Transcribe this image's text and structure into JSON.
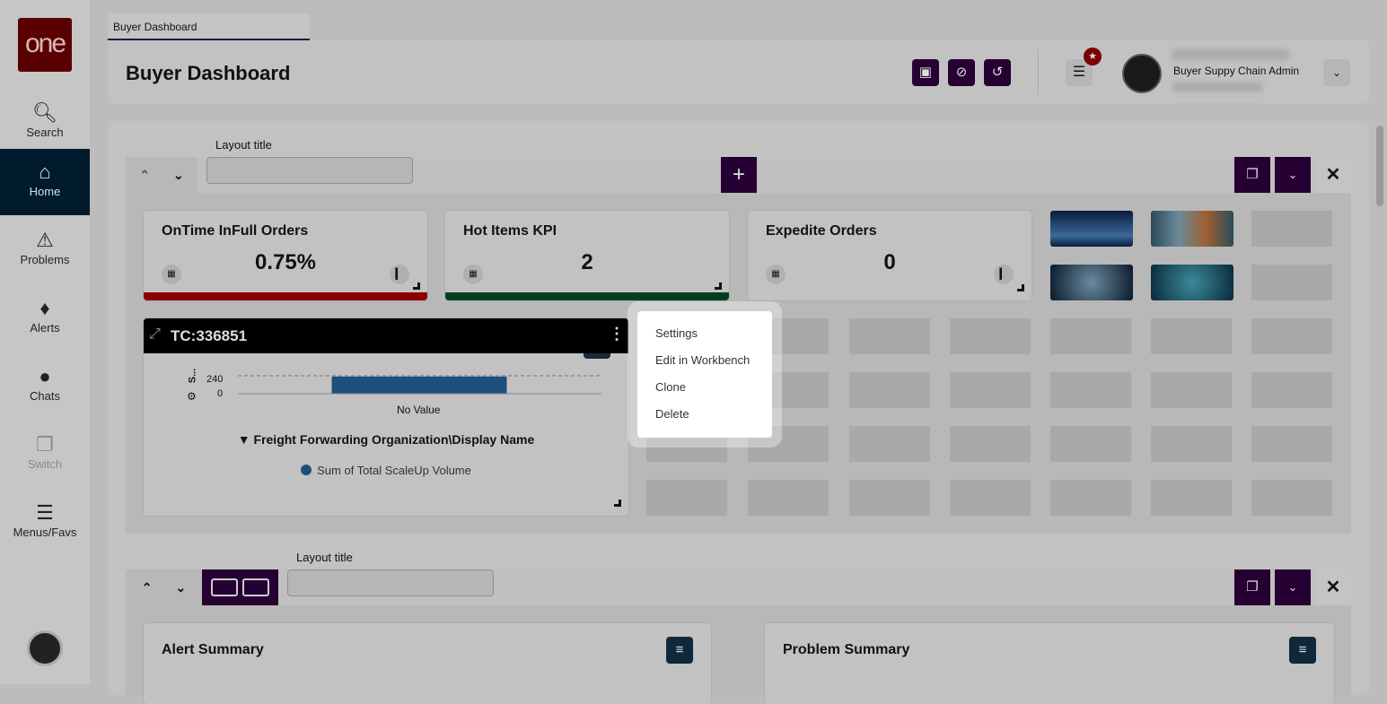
{
  "sidebar": {
    "logo": "one",
    "items": [
      {
        "label": "Search",
        "icon": "search-icon"
      },
      {
        "label": "Home",
        "icon": "home-icon",
        "active": true
      },
      {
        "label": "Problems",
        "icon": "warning-icon"
      },
      {
        "label": "Alerts",
        "icon": "bell-icon"
      },
      {
        "label": "Chats",
        "icon": "chat-icon"
      },
      {
        "label": "Switch",
        "icon": "switch-icon",
        "disabled": true
      },
      {
        "label": "Menus/Favs",
        "icon": "menu-icon"
      }
    ]
  },
  "tab": {
    "label": "Buyer Dashboard"
  },
  "header": {
    "title": "Buyer Dashboard",
    "user_role": "Buyer Suppy Chain Admin"
  },
  "layout1": {
    "title_label": "Layout title",
    "title_value": "",
    "kpis": [
      {
        "title": "OnTime InFull Orders",
        "value": "0.75%",
        "bar_color": "#8b0000"
      },
      {
        "title": "Hot Items KPI",
        "value": "2",
        "bar_color": "#004020"
      },
      {
        "title": "Expedite Orders",
        "value": "0",
        "bar_color": ""
      }
    ]
  },
  "widget": {
    "title": "TC:336851",
    "y_axis_label": "S...",
    "chart_data": {
      "type": "bar",
      "categories": [
        "No Value"
      ],
      "values": [
        230
      ],
      "ylim": [
        0,
        240
      ],
      "ticks": [
        "240",
        "0"
      ],
      "series": [
        {
          "name": "Sum of Total ScaleUp Volume",
          "color": "#1d4f7c"
        }
      ]
    },
    "filter": "Freight Forwarding Organization\\Display Name"
  },
  "context_menu": {
    "items": [
      "Settings",
      "Edit in Workbench",
      "Clone",
      "Delete"
    ]
  },
  "layout2": {
    "title_label": "Layout title",
    "title_value": "",
    "cards": [
      "Alert Summary",
      "Problem Summary"
    ]
  }
}
